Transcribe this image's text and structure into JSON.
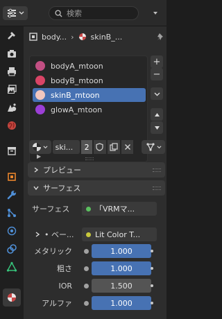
{
  "header": {
    "search_placeholder": "検索"
  },
  "breadcrumb": {
    "object": "body...",
    "material": "skinB_..."
  },
  "materials": [
    {
      "name": "bodyA_mtoon",
      "thumb": "#c24f83"
    },
    {
      "name": "bodyB_mtoon",
      "thumb": "#d94466"
    },
    {
      "name": "skinB_mtoon",
      "thumb": "#f2c7bf"
    },
    {
      "name": "glowA_mtoon",
      "thumb": "#9c3fd6"
    }
  ],
  "material_slot": {
    "name": "ski...",
    "users": "2"
  },
  "panels": {
    "preview": "プレビュー",
    "surface": "サーフェス"
  },
  "surface": {
    "label": "サーフェス",
    "value": "「VRMマ...",
    "base_label": "• ベー...",
    "base_value": "Lit Color T..."
  },
  "properties": [
    {
      "label": "メタリック",
      "value": "1.000",
      "style": "blue"
    },
    {
      "label": "粗さ",
      "value": "1.000",
      "style": "blue"
    },
    {
      "label": "IOR",
      "value": "1.500",
      "style": "gray"
    },
    {
      "label": "アルファ",
      "value": "1.000",
      "style": "blue"
    }
  ],
  "colors": {
    "selection": "#4772b3",
    "active_tab": "#3a3a3a",
    "surface_dot": "#5bc05f",
    "base_dot": "#c8c83c"
  }
}
